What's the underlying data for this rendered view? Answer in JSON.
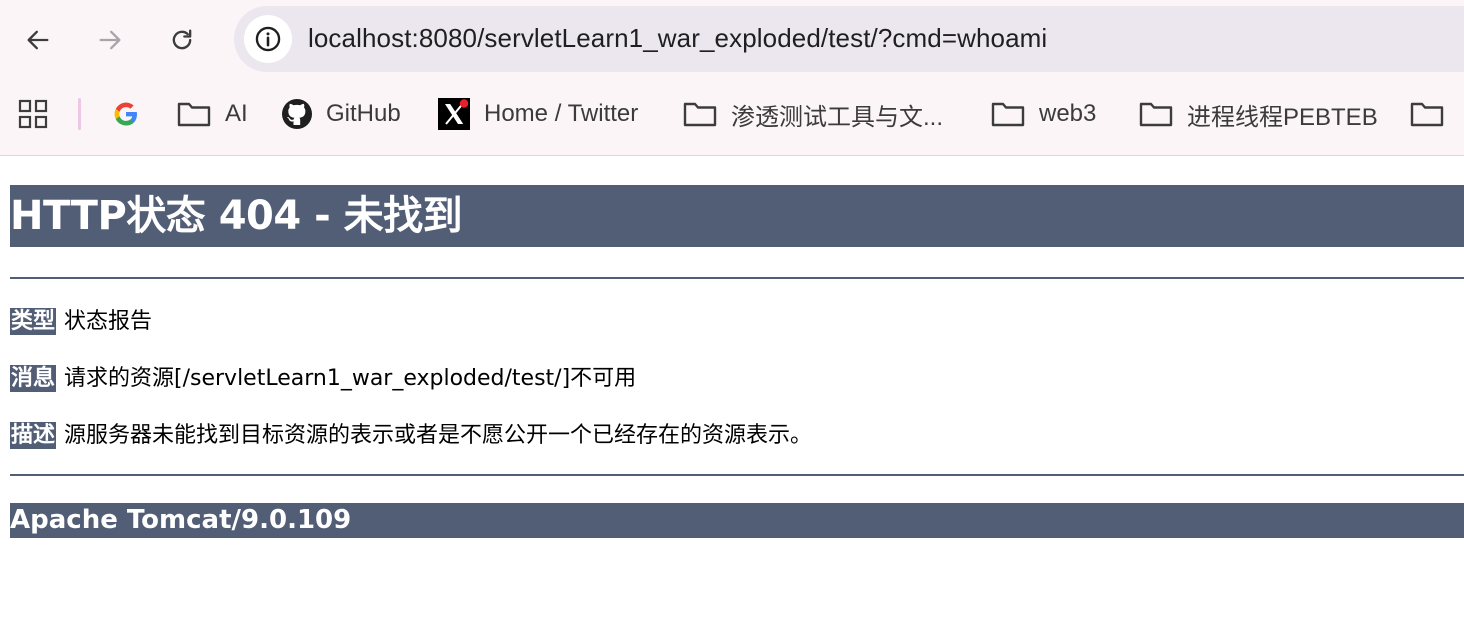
{
  "browser": {
    "url": "localhost:8080/servletLearn1_war_exploded/test/?cmd=whoami",
    "bookmarks": [
      {
        "label": "AI",
        "icon": "folder-icon"
      },
      {
        "label": "GitHub",
        "icon": "github-icon"
      },
      {
        "label": "Home / Twitter",
        "icon": "x-twitter-icon"
      },
      {
        "label": "渗透测试工具与文...",
        "icon": "folder-icon"
      },
      {
        "label": "web3",
        "icon": "folder-icon"
      },
      {
        "label": "进程线程PEBTEB",
        "icon": "folder-icon"
      }
    ]
  },
  "page": {
    "title": "HTTP状态 404 - 未找到",
    "type_label": "类型",
    "type_value": "状态报告",
    "message_label": "消息",
    "message_value": "请求的资源[/servletLearn1_war_exploded/test/]不可用",
    "description_label": "描述",
    "description_value": "源服务器未能找到目标资源的表示或者是不愿公开一个已经存在的资源表示。",
    "footer": "Apache Tomcat/9.0.109"
  },
  "colors": {
    "tomcat_bar": "#525d76",
    "chrome_bg": "#fbf5f8",
    "omnibox_bg": "#ece6ee"
  }
}
